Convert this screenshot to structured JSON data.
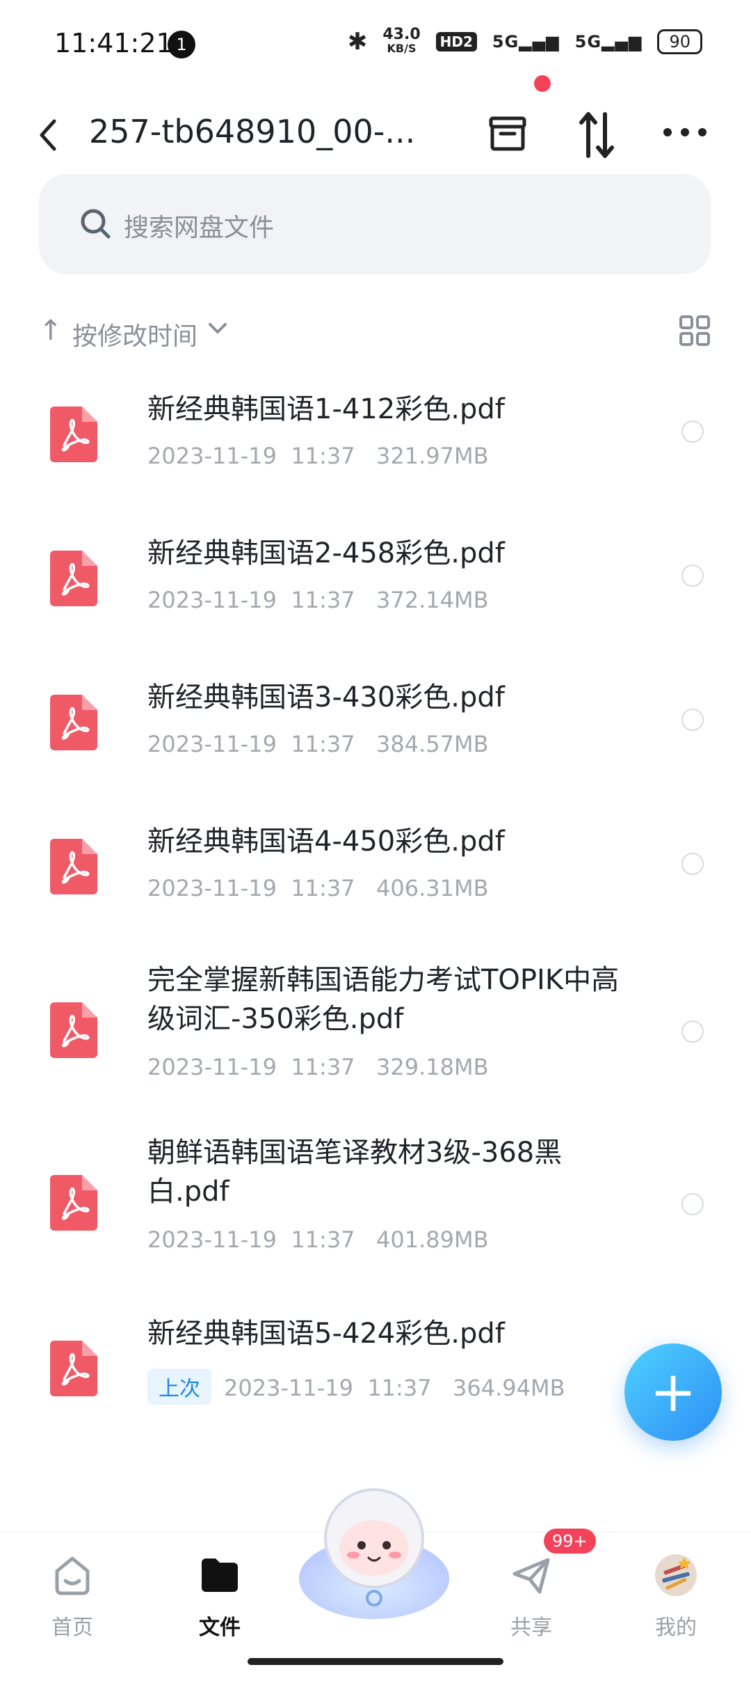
{
  "status_bar": {
    "time": "11:41:21",
    "notification_count": "1",
    "net_speed": "43.0",
    "net_unit": "KB/S",
    "hd_label": "HD2",
    "signal1": "5G",
    "signal2": "5G",
    "battery": "90"
  },
  "header": {
    "title": "257-tb648910_00-..."
  },
  "search": {
    "placeholder": "搜索网盘文件"
  },
  "sort": {
    "label": "按修改时间"
  },
  "files": [
    {
      "name": "新经典韩国语1-412彩色.pdf",
      "date": "2023-11-19",
      "time": "11:37",
      "size": "321.97MB"
    },
    {
      "name": "新经典韩国语2-458彩色.pdf",
      "date": "2023-11-19",
      "time": "11:37",
      "size": "372.14MB"
    },
    {
      "name": "新经典韩国语3-430彩色.pdf",
      "date": "2023-11-19",
      "time": "11:37",
      "size": "384.57MB"
    },
    {
      "name": "新经典韩国语4-450彩色.pdf",
      "date": "2023-11-19",
      "time": "11:37",
      "size": "406.31MB"
    },
    {
      "name": "完全掌握新韩国语能力考试TOPIK中高级词汇-350彩色.pdf",
      "date": "2023-11-19",
      "time": "11:37",
      "size": "329.18MB"
    },
    {
      "name": "朝鲜语韩国语笔译教材3级-368黑白.pdf",
      "date": "2023-11-19",
      "time": "11:37",
      "size": "401.89MB"
    },
    {
      "name": "新经典韩国语5-424彩色.pdf",
      "date": "2023-11-19",
      "time": "11:37",
      "size": "364.94MB",
      "badge": "上次"
    }
  ],
  "tabs": [
    {
      "label": "首页"
    },
    {
      "label": "文件"
    },
    {
      "label": "共享",
      "badge": "99+"
    },
    {
      "label": "我的"
    }
  ],
  "colors": {
    "accent": "#2d8ff5",
    "pdf_icon": "#f05a67",
    "badge_red": "#f2435a"
  }
}
